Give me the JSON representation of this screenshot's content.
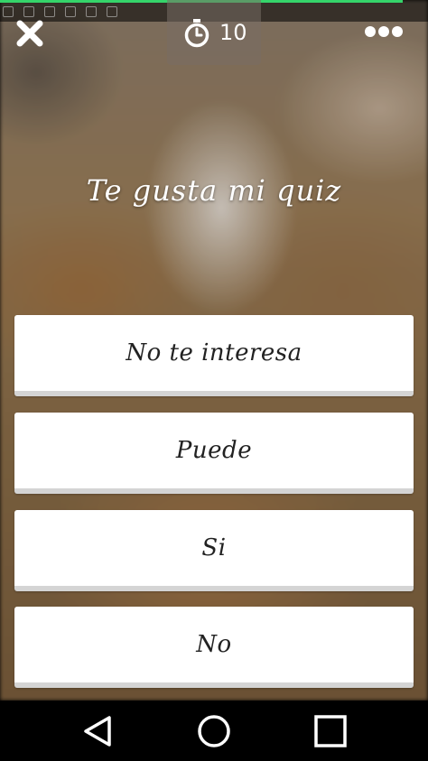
{
  "quiz": {
    "progress_fraction": 0.94,
    "timer_seconds": "10",
    "question": "Te gusta mi quiz",
    "answers": [
      "No te interesa",
      "Puede",
      "Si",
      "No"
    ]
  },
  "icons": {
    "close": "close-icon",
    "timer": "stopwatch-icon",
    "more": "more-options-icon",
    "back": "back-icon",
    "home": "home-icon",
    "recents": "recents-icon"
  },
  "colors": {
    "progress": "#35d46a",
    "answer_bg": "#ffffff",
    "answer_border": "#d4d4d4",
    "text_light": "#ffffff",
    "text_dark": "#222222"
  }
}
